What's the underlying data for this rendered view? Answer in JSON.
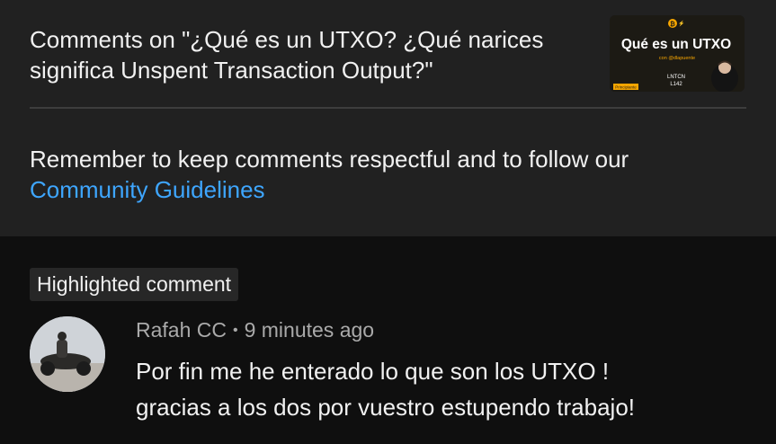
{
  "header": {
    "title": "Comments on \"¿Qué es un UTXO? ¿Qué narices significa Unspent Transaction Output?\"",
    "thumbnail": {
      "headline": "Qué es un UTXO",
      "subtitle": "con @dlapuente",
      "tag": "Principiante",
      "episode_line1": "LNTCN",
      "episode_line2": "L142"
    },
    "reminder_text": "Remember to keep comments respectful and to follow our ",
    "guidelines_link": "Community Guidelines"
  },
  "highlighted_label": "Highlighted comment",
  "comment": {
    "author": "Rafah CC",
    "separator": "•",
    "time": "9 minutes ago",
    "lines": [
      "Por fin me he enterado lo que son los UTXO !",
      "gracias a los dos por vuestro estupendo trabajo!"
    ]
  },
  "colors": {
    "header_bg": "#212121",
    "page_bg": "#0f0f0f",
    "link": "#3ea6ff",
    "secondary_text": "#aaaaaa",
    "thumb_accent": "#f7a600"
  }
}
